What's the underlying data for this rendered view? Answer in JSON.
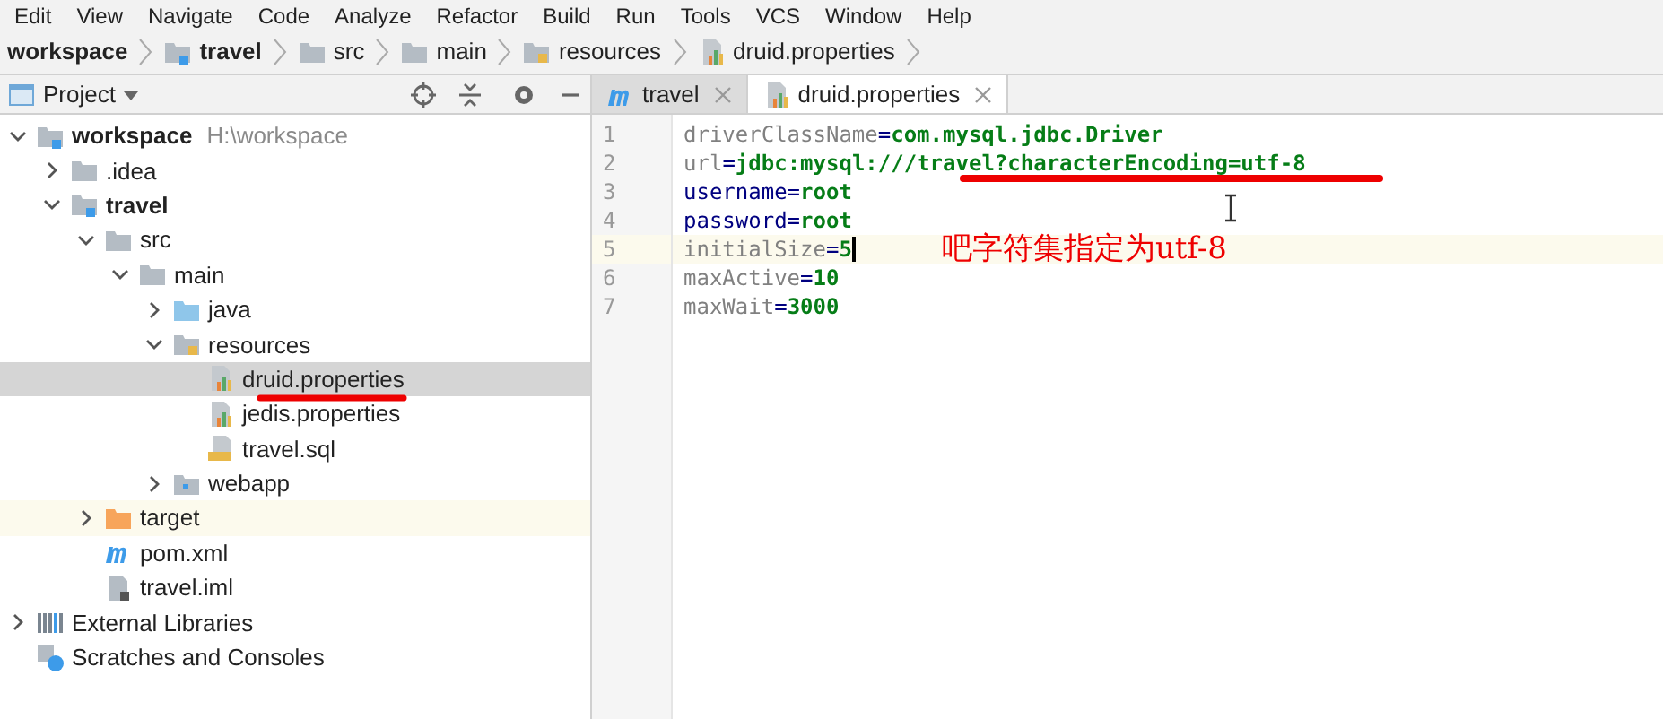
{
  "menu": [
    "Edit",
    "View",
    "Navigate",
    "Code",
    "Analyze",
    "Refactor",
    "Build",
    "Run",
    "Tools",
    "VCS",
    "Window",
    "Help"
  ],
  "breadcrumbs": [
    {
      "label": "workspace",
      "kind": "none",
      "bold": true
    },
    {
      "label": "travel",
      "kind": "module",
      "bold": true
    },
    {
      "label": "src",
      "kind": "folder",
      "bold": false
    },
    {
      "label": "main",
      "kind": "folder",
      "bold": false
    },
    {
      "label": "resources",
      "kind": "resources",
      "bold": false
    },
    {
      "label": "druid.properties",
      "kind": "properties",
      "bold": false
    }
  ],
  "project_panel": {
    "title": "Project"
  },
  "tabs": [
    {
      "label": "travel",
      "kind": "maven",
      "selected": false
    },
    {
      "label": "druid.properties",
      "kind": "properties",
      "selected": true
    }
  ],
  "tree": [
    {
      "label": "workspace",
      "hint": "H:\\workspace",
      "kind": "module",
      "bold": true,
      "expanded": true,
      "selected": false,
      "children": [
        {
          "label": ".idea",
          "kind": "folder",
          "bold": false,
          "expanded": false,
          "selected": false
        },
        {
          "label": "travel",
          "kind": "module",
          "bold": true,
          "expanded": true,
          "selected": false,
          "children": [
            {
              "label": "src",
              "kind": "folder",
              "bold": false,
              "expanded": true,
              "selected": false,
              "children": [
                {
                  "label": "main",
                  "kind": "folder",
                  "bold": false,
                  "expanded": true,
                  "selected": false,
                  "children": [
                    {
                      "label": "java",
                      "kind": "source",
                      "bold": false,
                      "expanded": false,
                      "selected": false
                    },
                    {
                      "label": "resources",
                      "kind": "resources",
                      "bold": false,
                      "expanded": true,
                      "selected": false,
                      "children": [
                        {
                          "label": "druid.properties",
                          "kind": "properties",
                          "bold": false,
                          "selected": true,
                          "underlined": true
                        },
                        {
                          "label": "jedis.properties",
                          "kind": "properties",
                          "bold": false,
                          "selected": false
                        },
                        {
                          "label": "travel.sql",
                          "kind": "sql",
                          "bold": false,
                          "selected": false
                        }
                      ]
                    },
                    {
                      "label": "webapp",
                      "kind": "web",
                      "bold": false,
                      "expanded": false,
                      "selected": false
                    }
                  ]
                }
              ]
            },
            {
              "label": "target",
              "kind": "excluded",
              "bold": false,
              "expanded": false,
              "selected": false,
              "highlighted": true
            },
            {
              "label": "pom.xml",
              "kind": "maven",
              "bold": false,
              "selected": false
            },
            {
              "label": "travel.iml",
              "kind": "iml",
              "bold": false,
              "selected": false
            }
          ]
        }
      ]
    },
    {
      "label": "External Libraries",
      "kind": "libraries",
      "bold": false,
      "expanded": false,
      "selected": false
    },
    {
      "label": "Scratches and Consoles",
      "kind": "scratches",
      "bold": false,
      "selected": false
    }
  ],
  "editor": {
    "lines": [
      {
        "number": "1",
        "key": "driverClassName",
        "sep": "=",
        "value": "com.mysql.jdbc.Driver",
        "kind": "plain",
        "current": false
      },
      {
        "number": "2",
        "key": "url",
        "sep": "=",
        "value": "jdbc:mysql:///travel?characterEncoding=utf-8",
        "kind": "plain",
        "current": false,
        "underlined": true
      },
      {
        "number": "3",
        "key": "username",
        "sep": "=",
        "value": "root",
        "kind": "known",
        "current": false
      },
      {
        "number": "4",
        "key": "password",
        "sep": "=",
        "value": "root",
        "kind": "known",
        "current": false
      },
      {
        "number": "5",
        "key": "initialSize",
        "sep": "=",
        "value": "5",
        "kind": "plain",
        "current": true
      },
      {
        "number": "6",
        "key": "maxActive",
        "sep": "=",
        "value": "10",
        "kind": "plain",
        "current": false
      },
      {
        "number": "7",
        "key": "maxWait",
        "sep": "=",
        "value": "3000",
        "kind": "plain",
        "current": false
      }
    ],
    "annotation": "吧字符集指定为utf-8"
  }
}
